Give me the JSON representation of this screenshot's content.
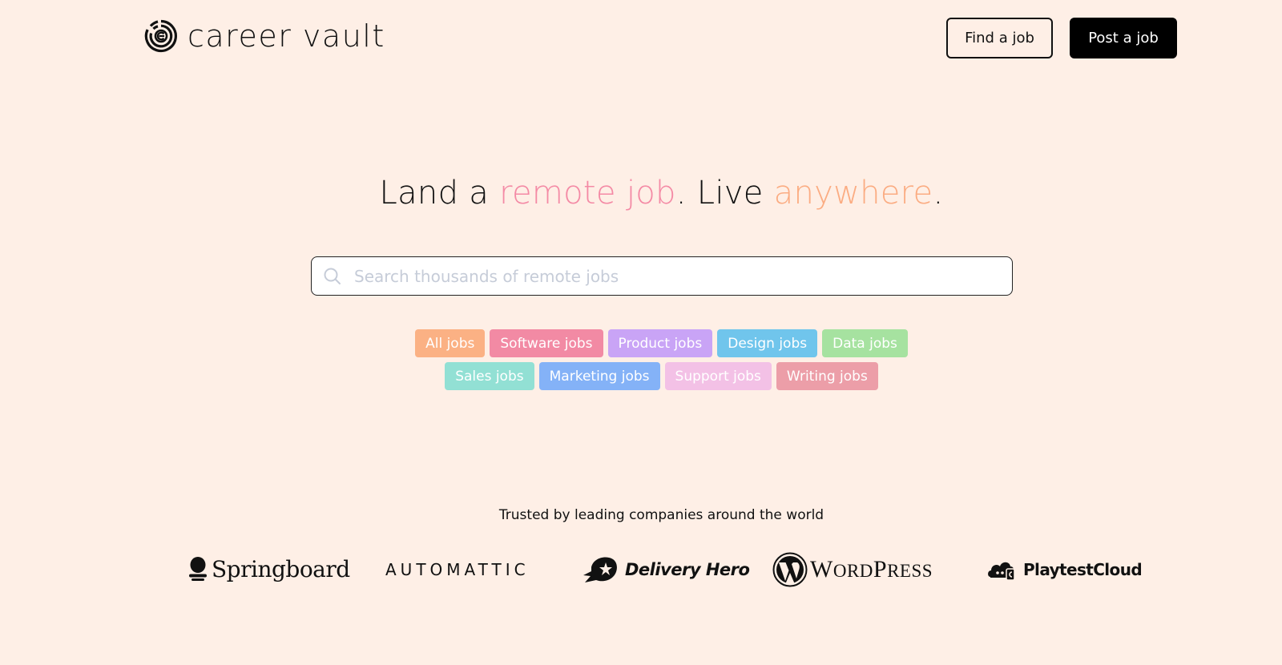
{
  "header": {
    "brand": "career vault",
    "find_job_label": "Find a job",
    "post_job_label": "Post a job"
  },
  "hero": {
    "title_parts": [
      "Land a ",
      "remote job",
      ". Live ",
      "anywhere",
      "."
    ],
    "accent_colors": {
      "remote_job": "#f48aa5",
      "anywhere": "#fbac82"
    }
  },
  "search": {
    "value": "",
    "placeholder": "Search thousands of remote jobs",
    "icon": "search-icon"
  },
  "categories": {
    "row1": [
      {
        "label": "All jobs",
        "color": "#fbb184"
      },
      {
        "label": "Software jobs",
        "color": "#f28aa4"
      },
      {
        "label": "Product jobs",
        "color": "#c9a4f6"
      },
      {
        "label": "Design jobs",
        "color": "#70c5ec"
      },
      {
        "label": "Data jobs",
        "color": "#a6e2a0"
      }
    ],
    "row2": [
      {
        "label": "Sales jobs",
        "color": "#92e0d4"
      },
      {
        "label": "Marketing jobs",
        "color": "#84b2f7"
      },
      {
        "label": "Support jobs",
        "color": "#f3c1e6"
      },
      {
        "label": "Writing jobs",
        "color": "#ec9ea8"
      }
    ]
  },
  "trusted": {
    "heading": "Trusted by leading companies around the world",
    "companies": [
      "Springboard",
      "AUTOMATTIC",
      "Delivery Hero",
      "WordPress",
      "PlaytestCloud"
    ],
    "wordpress_parts": [
      "W",
      "ORD",
      "P",
      "RESS"
    ]
  },
  "colors": {
    "background": "#feefe6",
    "primary_button": "#000000"
  }
}
